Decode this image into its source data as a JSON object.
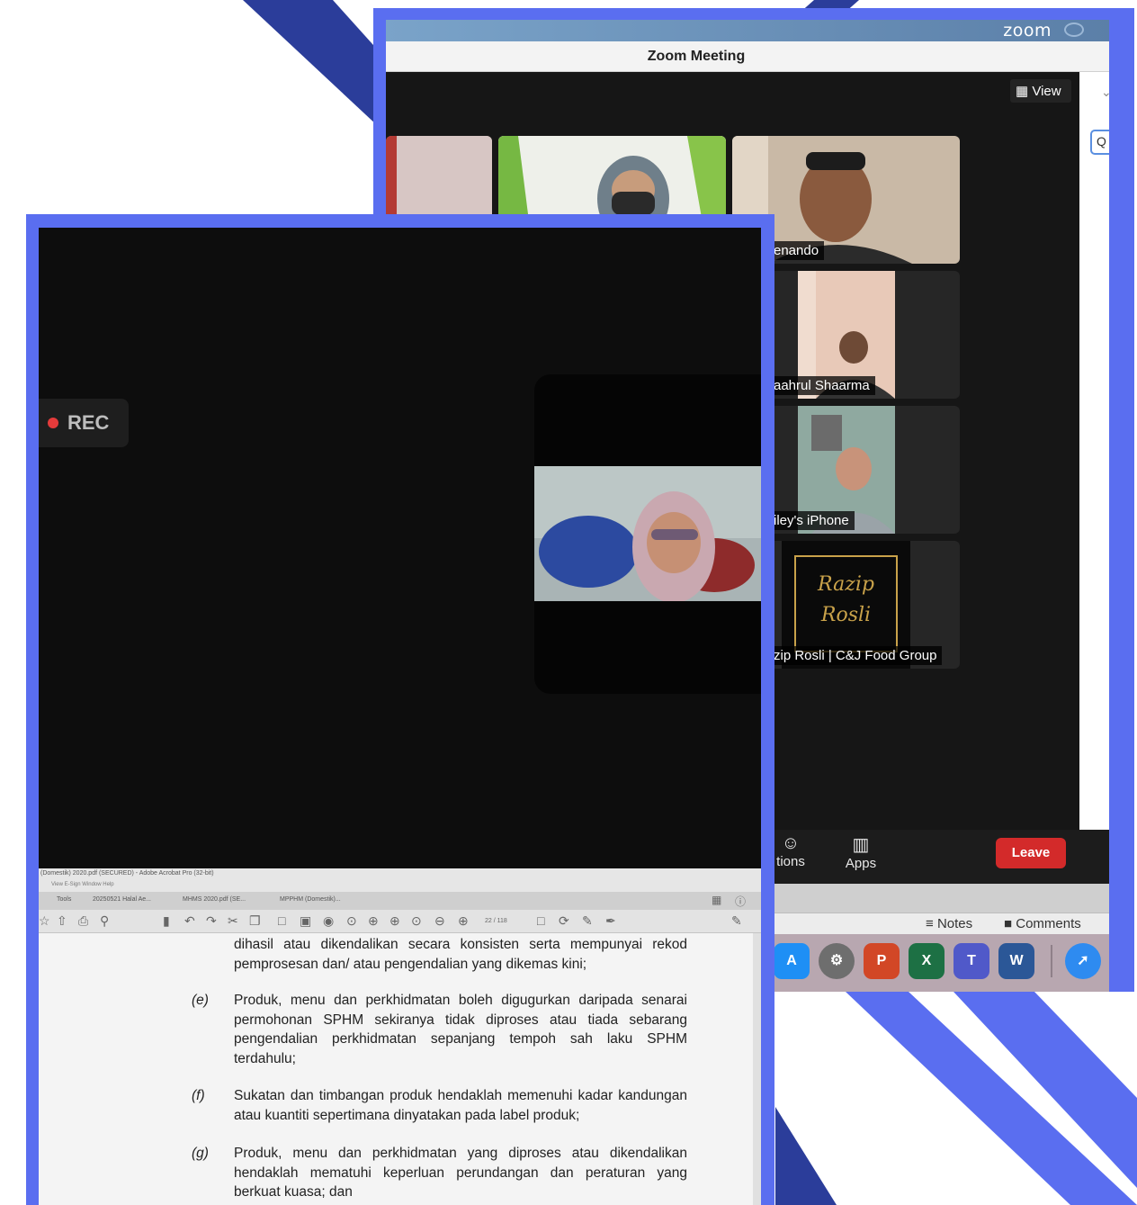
{
  "zoom": {
    "brand": "zoom",
    "title": "Zoom Meeting",
    "view_label": "View",
    "participants": [
      {
        "name": ""
      },
      {
        "name": ""
      },
      {
        "name": "enando"
      },
      {
        "name": "aahrul Shaarma"
      },
      {
        "name": "iley's iPhone"
      },
      {
        "name": "zip Rosli | C&J Food Group",
        "card_text_line1": "Razip",
        "card_text_line2": "Rosli"
      }
    ],
    "toolbar": {
      "reactions_label": "tions",
      "apps_label": "Apps",
      "leave_label": "Leave"
    },
    "notes_bar": {
      "notes_label": "Notes",
      "comments_label": "Comments"
    },
    "dock_icons": [
      "app-store",
      "system-preferences",
      "powerpoint",
      "excel",
      "teams",
      "word",
      "safari"
    ]
  },
  "recording": {
    "label": "REC"
  },
  "acrobat": {
    "title": "(Domestik) 2020.pdf (SECURED) - Adobe Acrobat Pro (32-bit)",
    "menu": "View  E-Sign  Window  Help",
    "tabs": [
      "Tools",
      "20250521 Halal Ae...",
      "MHMS 2020.pdf (SE...",
      "MPPHM (Domestik)..."
    ],
    "page_indicator": "22 / 118",
    "paragraphs": [
      {
        "label": "",
        "text": "dihasil atau dikendalikan secara konsisten serta mempunyai rekod pemprosesan dan/ atau pengendalian yang dikemas kini;"
      },
      {
        "label": "(e)",
        "text": "Produk, menu dan perkhidmatan boleh digugurkan daripada senarai permohonan SPHM sekiranya tidak diproses atau tiada sebarang pengendalian perkhidmatan sepanjang tempoh sah laku SPHM terdahulu;"
      },
      {
        "label": "(f)",
        "text": "Sukatan dan timbangan produk hendaklah memenuhi kadar kandungan atau kuantiti sepertimana dinyatakan pada label produk;"
      },
      {
        "label": "(g)",
        "text": "Produk, menu dan perkhidmatan yang diproses atau dikendalikan hendaklah mematuhi keperluan perundangan dan peraturan yang berkuat kuasa; dan"
      }
    ]
  },
  "colors": {
    "frame_blue": "#5a6ef0",
    "stripe_navy": "#2b3d9a",
    "leave_red": "#d32a2a"
  }
}
